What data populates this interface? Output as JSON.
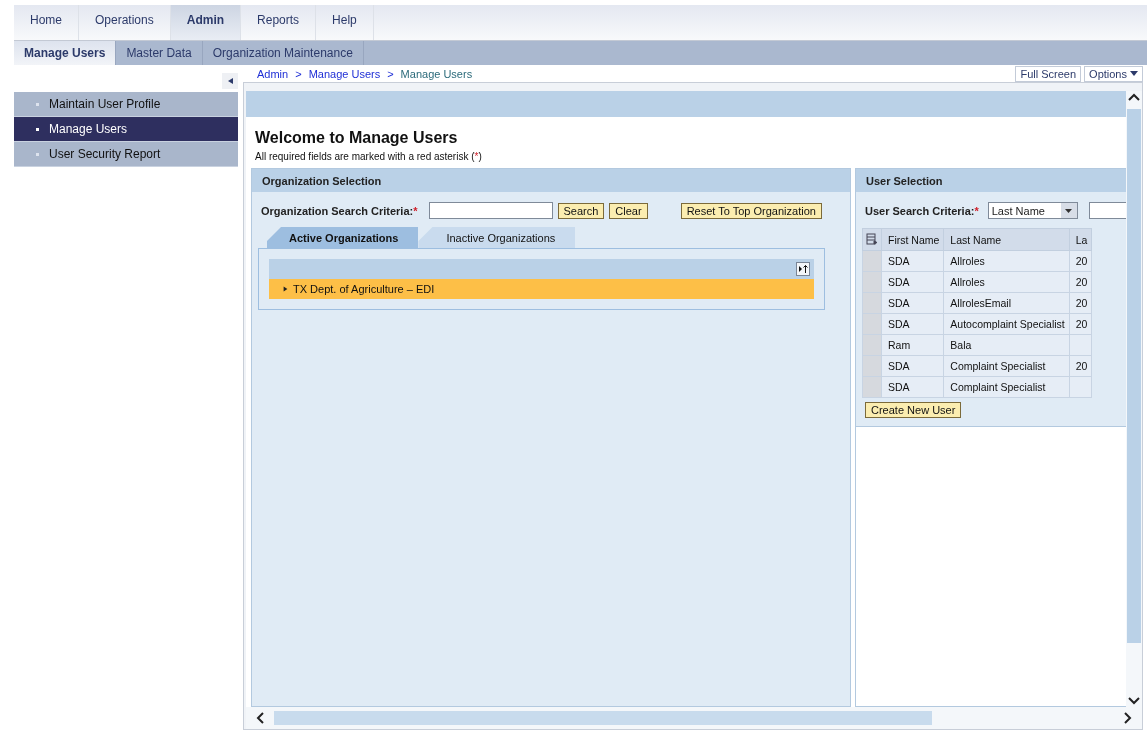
{
  "top_tabs": [
    {
      "label": "Home",
      "selected": false
    },
    {
      "label": "Operations",
      "selected": false
    },
    {
      "label": "Admin",
      "selected": true
    },
    {
      "label": "Reports",
      "selected": false
    },
    {
      "label": "Help",
      "selected": false
    }
  ],
  "sub_tabs": [
    {
      "label": "Manage Users",
      "selected": true
    },
    {
      "label": "Master Data",
      "selected": false
    },
    {
      "label": "Organization Maintenance",
      "selected": false
    }
  ],
  "sidebar": {
    "items": [
      {
        "label": "Maintain User Profile",
        "selected": false
      },
      {
        "label": "Manage Users",
        "selected": true
      },
      {
        "label": "User Security Report",
        "selected": false
      }
    ]
  },
  "breadcrumb": [
    {
      "label": "Admin",
      "kind": "link"
    },
    {
      "label": ">",
      "kind": "separator"
    },
    {
      "label": "Manage Users",
      "kind": "link"
    },
    {
      "label": ">",
      "kind": "separator"
    },
    {
      "label": "Manage Users",
      "kind": "current"
    }
  ],
  "header_buttons": [
    {
      "label": "Full Screen",
      "kind": "plain"
    },
    {
      "label": "Options",
      "kind": "menu"
    }
  ],
  "page": {
    "title": "Welcome to Manage Users",
    "note_before": "All required fields are marked with a red asterisk (",
    "note_mark": "*",
    "note_after": ")"
  },
  "org_panel": {
    "title": "Organization Selection",
    "search_label": "Organization Search Criteria:",
    "required_mark": "*",
    "buttons": [
      "Search",
      "Clear"
    ],
    "reset_button": "Reset To Top Organization",
    "tabs": [
      {
        "label": "Active Organizations",
        "selected": true
      },
      {
        "label": "Inactive Organizations",
        "selected": false
      }
    ],
    "tree": [
      {
        "label": "TX Dept. of Agriculture – EDI",
        "expanded": false,
        "selected": true
      }
    ]
  },
  "user_panel": {
    "title": "User Selection",
    "search_label": "User Search Criteria:",
    "required_mark": "*",
    "search_field": "Last Name",
    "columns": [
      "First Name",
      "Last Name",
      "La"
    ],
    "rows": [
      [
        "SDA",
        "Allroles",
        "20"
      ],
      [
        "SDA",
        "Allroles",
        "20"
      ],
      [
        "SDA",
        "AllrolesEmail",
        "20"
      ],
      [
        "SDA",
        "Autocomplaint Specialist",
        "20"
      ],
      [
        "Ram",
        "Bala",
        ""
      ],
      [
        "SDA",
        "Complaint Specialist",
        "20"
      ],
      [
        "SDA",
        "Complaint Specialist",
        ""
      ]
    ],
    "create_button": "Create New User"
  }
}
